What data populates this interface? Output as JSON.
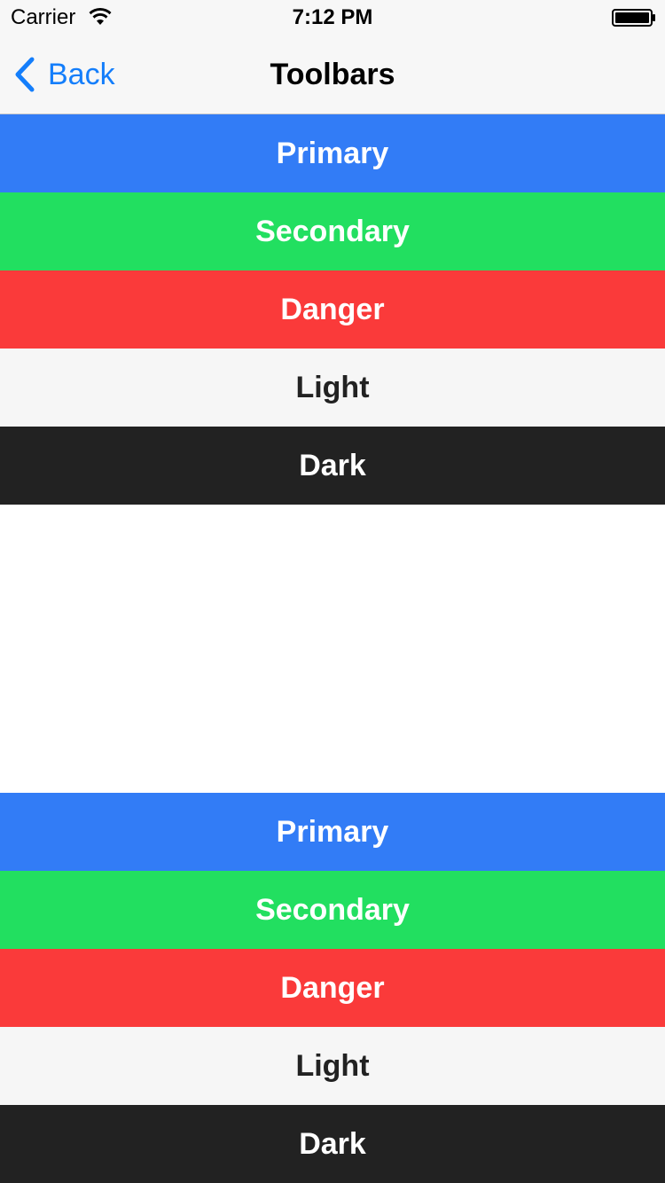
{
  "status_bar": {
    "carrier": "Carrier",
    "time": "7:12 PM",
    "wifi_icon": "wifi-icon",
    "battery_icon": "battery-icon"
  },
  "nav_bar": {
    "back_label": "Back",
    "back_icon": "chevron-left-icon",
    "title": "Toolbars",
    "accent_color": "#147efb"
  },
  "top_toolbars": [
    {
      "label": "Primary",
      "color": "#327cf6"
    },
    {
      "label": "Secondary",
      "color": "#22df60"
    },
    {
      "label": "Danger",
      "color": "#fa3a3a"
    },
    {
      "label": "Light",
      "color": "#f6f6f6"
    },
    {
      "label": "Dark",
      "color": "#222222"
    }
  ],
  "bottom_toolbars": [
    {
      "label": "Primary",
      "color": "#327cf6"
    },
    {
      "label": "Secondary",
      "color": "#22df60"
    },
    {
      "label": "Danger",
      "color": "#fa3a3a"
    },
    {
      "label": "Light",
      "color": "#f6f6f6"
    },
    {
      "label": "Dark",
      "color": "#222222"
    }
  ]
}
